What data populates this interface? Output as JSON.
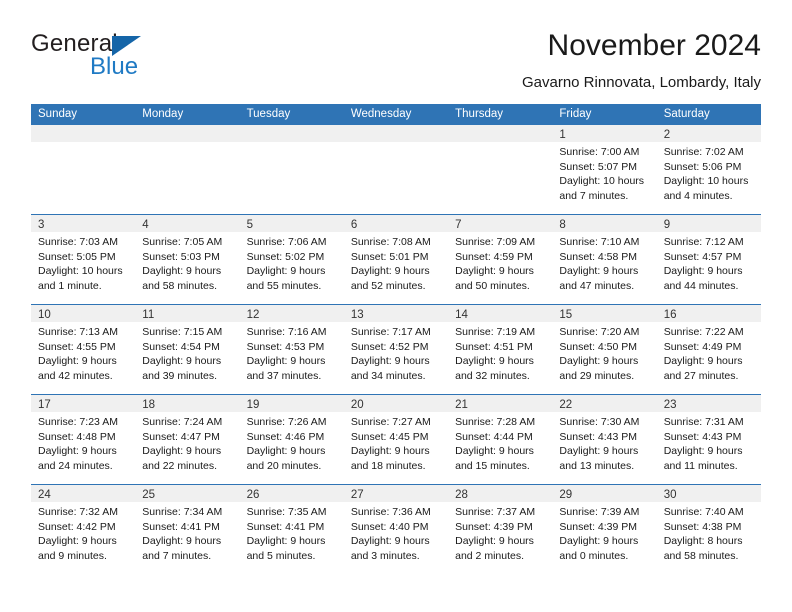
{
  "brand": {
    "word1": "General",
    "word2": "Blue",
    "triangle_color": "#1565a8",
    "blue_color": "#1f7ac4"
  },
  "header": {
    "title": "November 2024",
    "subtitle": "Gavarno Rinnovata, Lombardy, Italy"
  },
  "theme": {
    "header_blue": "#2f74b5",
    "day_band_gray": "#f0f0f0",
    "text": "#1a1a1a"
  },
  "weekdays": [
    "Sunday",
    "Monday",
    "Tuesday",
    "Wednesday",
    "Thursday",
    "Friday",
    "Saturday"
  ],
  "weeks": [
    [
      {
        "day": "",
        "lines": []
      },
      {
        "day": "",
        "lines": []
      },
      {
        "day": "",
        "lines": []
      },
      {
        "day": "",
        "lines": []
      },
      {
        "day": "",
        "lines": []
      },
      {
        "day": "1",
        "lines": [
          "Sunrise: 7:00 AM",
          "Sunset: 5:07 PM",
          "Daylight: 10 hours",
          "and 7 minutes."
        ]
      },
      {
        "day": "2",
        "lines": [
          "Sunrise: 7:02 AM",
          "Sunset: 5:06 PM",
          "Daylight: 10 hours",
          "and 4 minutes."
        ]
      }
    ],
    [
      {
        "day": "3",
        "lines": [
          "Sunrise: 7:03 AM",
          "Sunset: 5:05 PM",
          "Daylight: 10 hours",
          "and 1 minute."
        ]
      },
      {
        "day": "4",
        "lines": [
          "Sunrise: 7:05 AM",
          "Sunset: 5:03 PM",
          "Daylight: 9 hours",
          "and 58 minutes."
        ]
      },
      {
        "day": "5",
        "lines": [
          "Sunrise: 7:06 AM",
          "Sunset: 5:02 PM",
          "Daylight: 9 hours",
          "and 55 minutes."
        ]
      },
      {
        "day": "6",
        "lines": [
          "Sunrise: 7:08 AM",
          "Sunset: 5:01 PM",
          "Daylight: 9 hours",
          "and 52 minutes."
        ]
      },
      {
        "day": "7",
        "lines": [
          "Sunrise: 7:09 AM",
          "Sunset: 4:59 PM",
          "Daylight: 9 hours",
          "and 50 minutes."
        ]
      },
      {
        "day": "8",
        "lines": [
          "Sunrise: 7:10 AM",
          "Sunset: 4:58 PM",
          "Daylight: 9 hours",
          "and 47 minutes."
        ]
      },
      {
        "day": "9",
        "lines": [
          "Sunrise: 7:12 AM",
          "Sunset: 4:57 PM",
          "Daylight: 9 hours",
          "and 44 minutes."
        ]
      }
    ],
    [
      {
        "day": "10",
        "lines": [
          "Sunrise: 7:13 AM",
          "Sunset: 4:55 PM",
          "Daylight: 9 hours",
          "and 42 minutes."
        ]
      },
      {
        "day": "11",
        "lines": [
          "Sunrise: 7:15 AM",
          "Sunset: 4:54 PM",
          "Daylight: 9 hours",
          "and 39 minutes."
        ]
      },
      {
        "day": "12",
        "lines": [
          "Sunrise: 7:16 AM",
          "Sunset: 4:53 PM",
          "Daylight: 9 hours",
          "and 37 minutes."
        ]
      },
      {
        "day": "13",
        "lines": [
          "Sunrise: 7:17 AM",
          "Sunset: 4:52 PM",
          "Daylight: 9 hours",
          "and 34 minutes."
        ]
      },
      {
        "day": "14",
        "lines": [
          "Sunrise: 7:19 AM",
          "Sunset: 4:51 PM",
          "Daylight: 9 hours",
          "and 32 minutes."
        ]
      },
      {
        "day": "15",
        "lines": [
          "Sunrise: 7:20 AM",
          "Sunset: 4:50 PM",
          "Daylight: 9 hours",
          "and 29 minutes."
        ]
      },
      {
        "day": "16",
        "lines": [
          "Sunrise: 7:22 AM",
          "Sunset: 4:49 PM",
          "Daylight: 9 hours",
          "and 27 minutes."
        ]
      }
    ],
    [
      {
        "day": "17",
        "lines": [
          "Sunrise: 7:23 AM",
          "Sunset: 4:48 PM",
          "Daylight: 9 hours",
          "and 24 minutes."
        ]
      },
      {
        "day": "18",
        "lines": [
          "Sunrise: 7:24 AM",
          "Sunset: 4:47 PM",
          "Daylight: 9 hours",
          "and 22 minutes."
        ]
      },
      {
        "day": "19",
        "lines": [
          "Sunrise: 7:26 AM",
          "Sunset: 4:46 PM",
          "Daylight: 9 hours",
          "and 20 minutes."
        ]
      },
      {
        "day": "20",
        "lines": [
          "Sunrise: 7:27 AM",
          "Sunset: 4:45 PM",
          "Daylight: 9 hours",
          "and 18 minutes."
        ]
      },
      {
        "day": "21",
        "lines": [
          "Sunrise: 7:28 AM",
          "Sunset: 4:44 PM",
          "Daylight: 9 hours",
          "and 15 minutes."
        ]
      },
      {
        "day": "22",
        "lines": [
          "Sunrise: 7:30 AM",
          "Sunset: 4:43 PM",
          "Daylight: 9 hours",
          "and 13 minutes."
        ]
      },
      {
        "day": "23",
        "lines": [
          "Sunrise: 7:31 AM",
          "Sunset: 4:43 PM",
          "Daylight: 9 hours",
          "and 11 minutes."
        ]
      }
    ],
    [
      {
        "day": "24",
        "lines": [
          "Sunrise: 7:32 AM",
          "Sunset: 4:42 PM",
          "Daylight: 9 hours",
          "and 9 minutes."
        ]
      },
      {
        "day": "25",
        "lines": [
          "Sunrise: 7:34 AM",
          "Sunset: 4:41 PM",
          "Daylight: 9 hours",
          "and 7 minutes."
        ]
      },
      {
        "day": "26",
        "lines": [
          "Sunrise: 7:35 AM",
          "Sunset: 4:41 PM",
          "Daylight: 9 hours",
          "and 5 minutes."
        ]
      },
      {
        "day": "27",
        "lines": [
          "Sunrise: 7:36 AM",
          "Sunset: 4:40 PM",
          "Daylight: 9 hours",
          "and 3 minutes."
        ]
      },
      {
        "day": "28",
        "lines": [
          "Sunrise: 7:37 AM",
          "Sunset: 4:39 PM",
          "Daylight: 9 hours",
          "and 2 minutes."
        ]
      },
      {
        "day": "29",
        "lines": [
          "Sunrise: 7:39 AM",
          "Sunset: 4:39 PM",
          "Daylight: 9 hours",
          "and 0 minutes."
        ]
      },
      {
        "day": "30",
        "lines": [
          "Sunrise: 7:40 AM",
          "Sunset: 4:38 PM",
          "Daylight: 8 hours",
          "and 58 minutes."
        ]
      }
    ]
  ]
}
